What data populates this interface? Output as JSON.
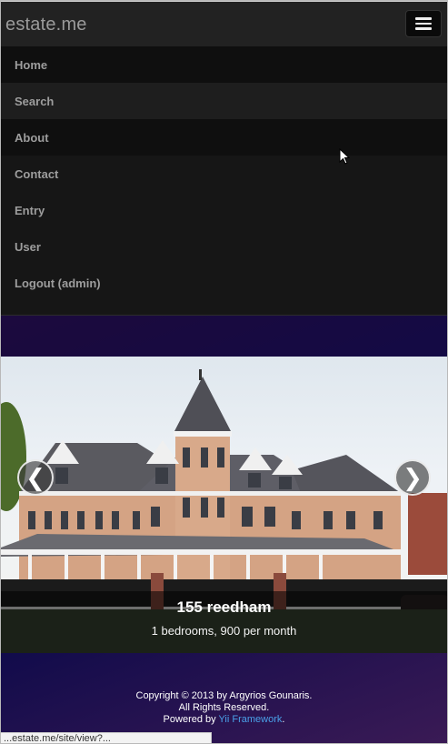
{
  "navbar": {
    "brand": "estate.me",
    "toggle_icon": "hamburger-menu-icon"
  },
  "menu": {
    "items": [
      {
        "label": "Home"
      },
      {
        "label": "Search"
      },
      {
        "label": "About"
      },
      {
        "label": "Contact"
      },
      {
        "label": "Entry"
      },
      {
        "label": "User"
      },
      {
        "label": "Logout (admin)"
      }
    ]
  },
  "carousel": {
    "prev_glyph": "❮",
    "next_glyph": "❯",
    "caption_title": "155 reedham",
    "caption_text": "1 bedrooms, 900 per month"
  },
  "footer": {
    "copyright": "Copyright © 2013 by Argyrios Gounaris.",
    "rights": "All Rights Reserved.",
    "powered_prefix": "Powered by ",
    "powered_link": "Yii Framework",
    "powered_suffix": ".",
    "link_color": "#4aa0e8"
  },
  "status_bar": {
    "text": "...estate.me/site/view?..."
  }
}
